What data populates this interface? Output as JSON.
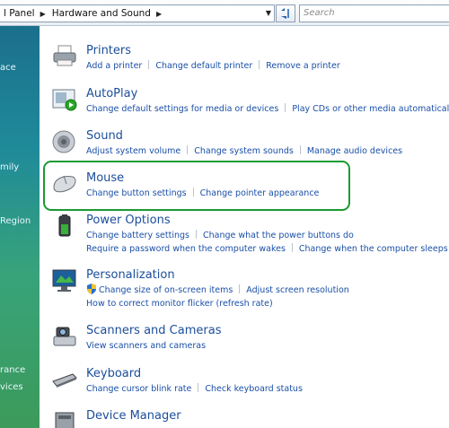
{
  "address": {
    "crumbs": [
      "l Panel",
      "Hardware and Sound"
    ],
    "search_placeholder": "Search"
  },
  "left_pane": [
    "ace",
    "mily",
    "Region",
    "rance",
    "vices"
  ],
  "categories": [
    {
      "title": "Printers",
      "icon": "printer-icon",
      "links": [
        [
          "Add a printer",
          "Change default printer",
          "Remove a printer"
        ]
      ]
    },
    {
      "title": "AutoPlay",
      "icon": "autoplay-icon",
      "links": [
        [
          "Change default settings for media or devices",
          "Play CDs or other media automatically"
        ]
      ]
    },
    {
      "title": "Sound",
      "icon": "speaker-icon",
      "links": [
        [
          "Adjust system volume",
          "Change system sounds",
          "Manage audio devices"
        ]
      ]
    },
    {
      "title": "Mouse",
      "icon": "mouse-icon",
      "links": [
        [
          "Change button settings",
          "Change pointer appearance"
        ]
      ]
    },
    {
      "title": "Power Options",
      "icon": "battery-icon",
      "links": [
        [
          "Change battery settings",
          "Change what the power buttons do"
        ],
        [
          "Require a password when the computer wakes",
          "Change when the computer sleeps"
        ]
      ]
    },
    {
      "title": "Personalization",
      "icon": "monitor-icon",
      "links": [
        [
          "Change size of on-screen items",
          "Adjust screen resolution"
        ],
        [
          "How to correct monitor flicker (refresh rate)"
        ]
      ]
    },
    {
      "title": "Scanners and Cameras",
      "icon": "camera-icon",
      "links": [
        [
          "View scanners and cameras"
        ]
      ]
    },
    {
      "title": "Keyboard",
      "icon": "keyboard-icon",
      "links": [
        [
          "Change cursor blink rate",
          "Check keyboard status"
        ]
      ]
    },
    {
      "title": "Device Manager",
      "icon": "device-manager-icon",
      "links": []
    }
  ],
  "colors": {
    "highlight": "#1a9a32",
    "link": "#1a4fa8",
    "title": "#1b4e9b"
  }
}
